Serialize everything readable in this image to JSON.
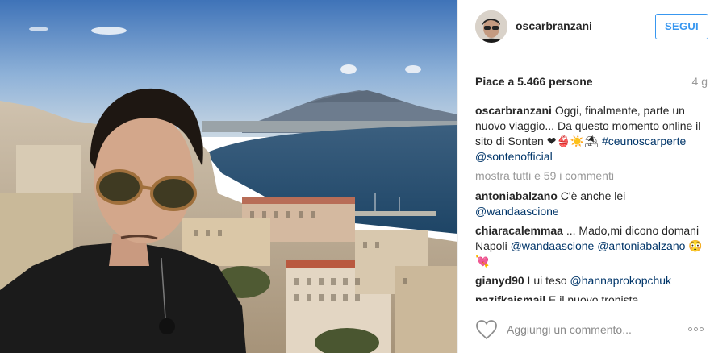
{
  "post": {
    "username": "oscarbranzani",
    "follow_label": "SEGUI",
    "likes_text": "Piace a 5.466 persone",
    "age": "4 g",
    "caption": {
      "user": "oscarbranzani",
      "text": "Oggi, finalmente, parte un nuovo viaggio... Da questo momento online il sito di Sonten ❤👙☀️⛱",
      "tags": [
        "#ceunoscarperte",
        "@sontenofficial"
      ]
    },
    "show_all_text": "mostra tutti e 59 i commenti",
    "comments": [
      {
        "user": "antoniabalzano",
        "text": "C'è anche lei",
        "mentions": [
          "@wandaascione"
        ]
      },
      {
        "user": "chiaracalemmaa",
        "text": "... Mado,mi dicono domani Napoli",
        "mentions": [
          "@wandaascione",
          "@antoniabalzano"
        ],
        "emoji": "😳💘"
      },
      {
        "user": "gianyd90",
        "text": "Lui teso",
        "mentions": [
          "@hannaprokopchuk"
        ]
      },
      {
        "user": "nazifkaismail",
        "text": "E il nuovo tronista"
      }
    ],
    "comment_placeholder": "Aggiungi un commento...",
    "colors": {
      "accent": "#3897f0",
      "tag": "#003569",
      "muted": "#999999"
    }
  },
  "icons": {
    "like": "heart-outline-icon",
    "more": "ellipsis-icon"
  }
}
